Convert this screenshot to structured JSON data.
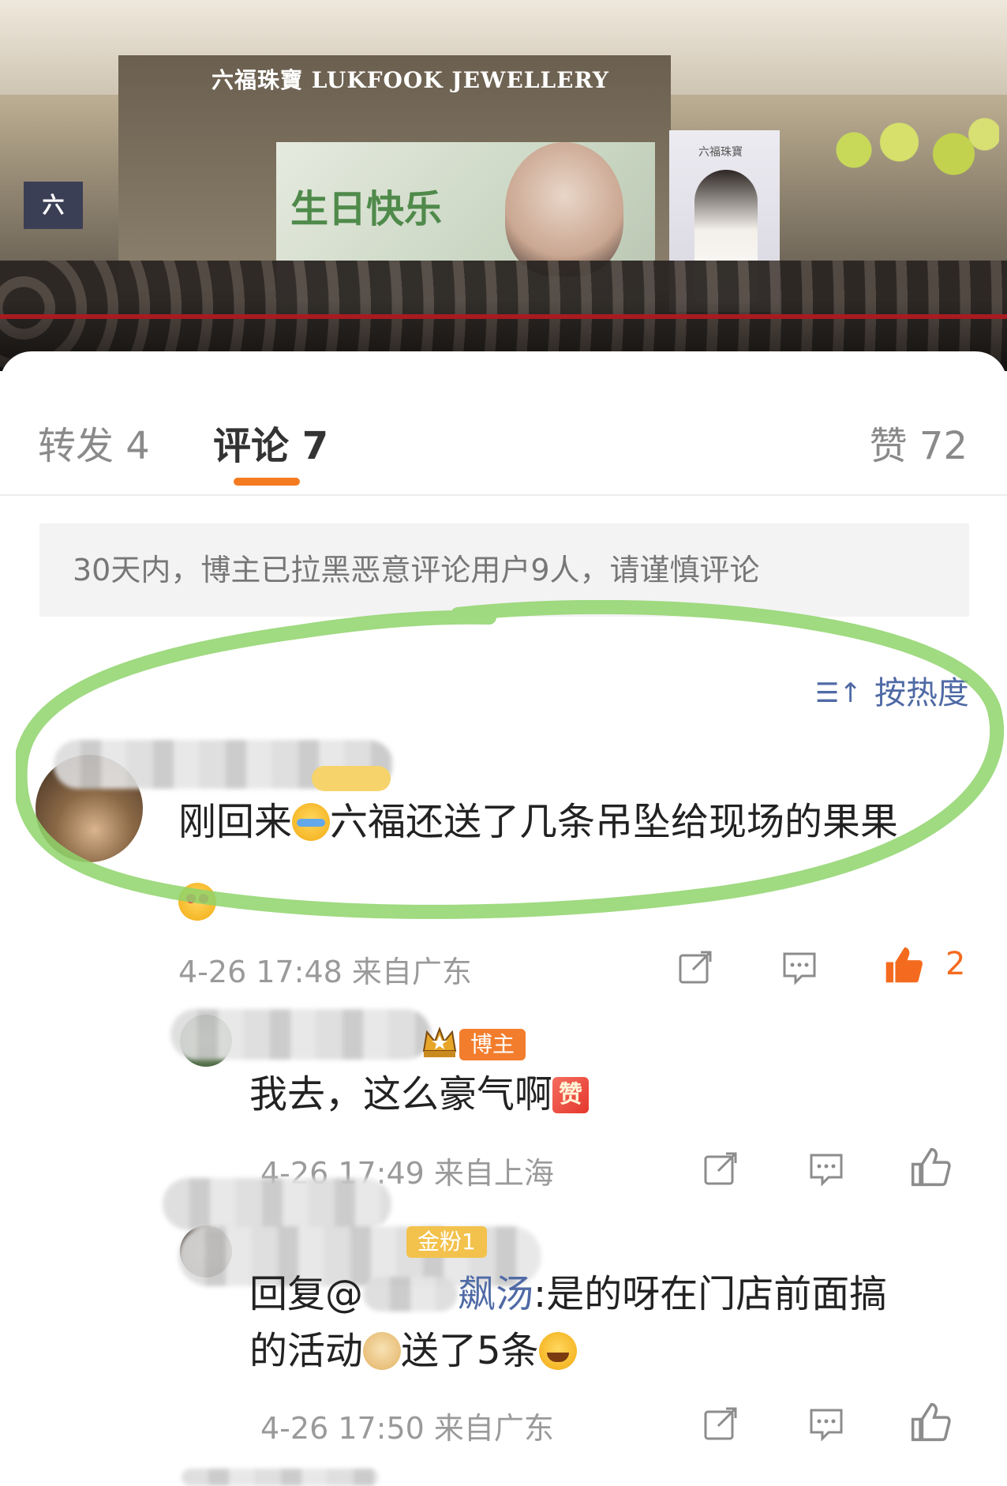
{
  "photo": {
    "store_sign": "六福珠寶 LUKFOOK JEWELLERY",
    "side_sign": "六",
    "backdrop_text": "生日快乐",
    "standee_logo": "六福珠寶"
  },
  "tabs": {
    "forward": "转发 4",
    "comment": "评论 7",
    "like": "赞 72"
  },
  "notice": "30天内，博主已拉黑恶意评论用户9人，请谨慎评论",
  "sort": {
    "icon": "sort-icon",
    "label": "按热度"
  },
  "comments": [
    {
      "text": "刚回来",
      "text_after_emoji": "六福还送了几条吊坠给现场的果果",
      "emoji_1": "cry-laugh-emoji",
      "emoji_2": "heart-eyes-emoji",
      "time": "4-26 17:48 来自广东",
      "likes": "2",
      "liked": true
    }
  ],
  "replies": [
    {
      "badge": "博主",
      "text": "我去，这么豪气啊",
      "emoji": "zan-emoji",
      "time": "4-26 17:49 来自上海"
    },
    {
      "badge": "金粉1",
      "reply_prefix": "回复@",
      "reply_target_visible": "飙汤",
      "text_line1": ":是的呀在门店前面搞",
      "text_line2_a": "的活动",
      "text_line2_b": "送了5条",
      "emoji_1": "doge-emoji",
      "emoji_2": "laugh-emoji",
      "time": "4-26 17:50 来自广东"
    }
  ],
  "colors": {
    "accent_orange": "#f47b1f",
    "link_blue": "#4f6aa5",
    "highlight_green": "#8fd46b",
    "badge_orange": "#f27d2d"
  }
}
